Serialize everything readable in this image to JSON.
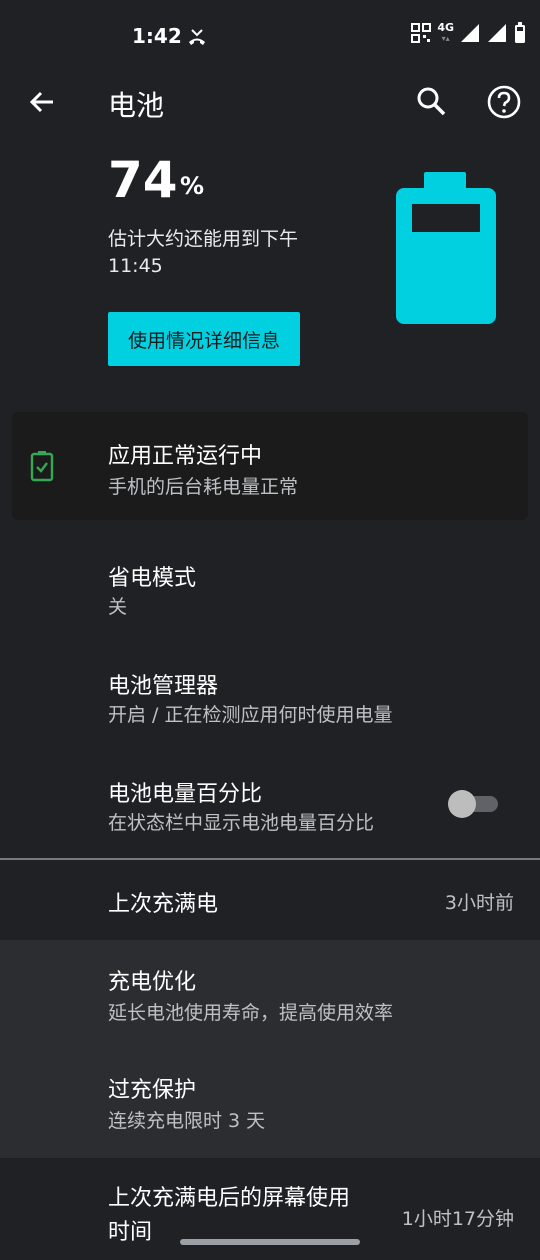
{
  "status_bar": {
    "time": "1:42",
    "network": "4G",
    "icons": [
      "missed-call-icon",
      "qr-icon",
      "signal-icon",
      "signal-icon",
      "battery-icon"
    ]
  },
  "app_bar": {
    "title": "电池",
    "back_icon": "arrow-left-icon",
    "search_icon": "search-icon",
    "help_icon": "help-icon"
  },
  "battery": {
    "level": "74",
    "unit": "%",
    "estimate_line1": "估计大约还能用到下午",
    "estimate_line2": "11:45",
    "details_button": "使用情况详细信息",
    "level_fraction": 0.74,
    "accent_color": "#00d0e0"
  },
  "status_card": {
    "title": "应用正常运行中",
    "subtitle": "手机的后台耗电量正常",
    "icon": "battery-check-icon",
    "icon_color": "#34a853"
  },
  "settings": [
    {
      "title": "省电模式",
      "subtitle": "关"
    },
    {
      "title": "电池管理器",
      "subtitle": "开启 / 正在检测应用何时使用电量"
    },
    {
      "title": "电池电量百分比",
      "subtitle": "在状态栏中显示电池电量百分比",
      "toggle": "off"
    }
  ],
  "last_full_charge": {
    "label": "上次充满电",
    "value": "3小时前"
  },
  "charging": [
    {
      "title": "充电优化",
      "subtitle": "延长电池使用寿命，提高使用效率"
    },
    {
      "title": "过充保护",
      "subtitle": "连续充电限时 3 天"
    }
  ],
  "screen_usage": {
    "label_line1": "上次充满电后的屏幕使用",
    "label_line2": "时间",
    "value": "1小时17分钟"
  }
}
